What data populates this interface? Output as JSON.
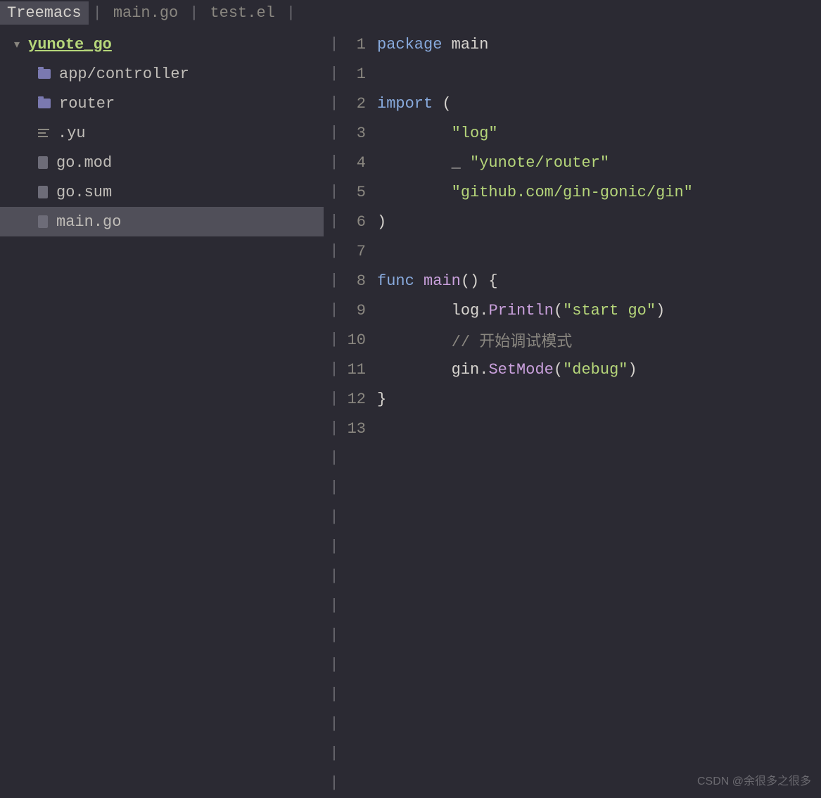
{
  "tabs": {
    "items": [
      "Treemacs",
      "main.go",
      "test.el"
    ],
    "active_index": 0,
    "separator": "|"
  },
  "tree": {
    "project": "yunote_go",
    "items": [
      {
        "type": "folder",
        "label": "app/controller"
      },
      {
        "type": "folder",
        "label": "router"
      },
      {
        "type": "text",
        "label": ".yu"
      },
      {
        "type": "file",
        "label": "go.mod"
      },
      {
        "type": "file",
        "label": "go.sum"
      },
      {
        "type": "file",
        "label": "main.go",
        "selected": true
      }
    ]
  },
  "editor": {
    "divider": "|",
    "lines": [
      {
        "n": "1",
        "tokens": [
          [
            "kw",
            "package "
          ],
          [
            "ident",
            "main"
          ]
        ]
      },
      {
        "n": "1",
        "tokens": []
      },
      {
        "n": "2",
        "tokens": [
          [
            "kw",
            "import "
          ],
          [
            "paren",
            "("
          ]
        ]
      },
      {
        "n": "3",
        "tokens": [
          [
            "ident",
            "        "
          ],
          [
            "str",
            "\"log\""
          ]
        ]
      },
      {
        "n": "4",
        "tokens": [
          [
            "ident",
            "        "
          ],
          [
            "punct",
            "_ "
          ],
          [
            "str",
            "\"yunote/router\""
          ]
        ]
      },
      {
        "n": "5",
        "tokens": [
          [
            "ident",
            "        "
          ],
          [
            "str",
            "\"github.com/gin-gonic/gin\""
          ]
        ]
      },
      {
        "n": "6",
        "tokens": [
          [
            "paren",
            ")"
          ]
        ]
      },
      {
        "n": "7",
        "tokens": []
      },
      {
        "n": "8",
        "tokens": [
          [
            "kw",
            "func "
          ],
          [
            "fn",
            "main"
          ],
          [
            "paren",
            "()"
          ],
          [
            "ident",
            " {"
          ]
        ]
      },
      {
        "n": "9",
        "tokens": [
          [
            "ident",
            "        log."
          ],
          [
            "fn",
            "Println"
          ],
          [
            "paren",
            "("
          ],
          [
            "str",
            "\"start go\""
          ],
          [
            "paren",
            ")"
          ]
        ]
      },
      {
        "n": "10",
        "tokens": [
          [
            "ident",
            "        "
          ],
          [
            "comment",
            "// 开始调试模式"
          ]
        ]
      },
      {
        "n": "11",
        "tokens": [
          [
            "ident",
            "        gin."
          ],
          [
            "fn",
            "SetMode"
          ],
          [
            "paren",
            "("
          ],
          [
            "str",
            "\"debug\""
          ],
          [
            "paren",
            ")"
          ]
        ]
      },
      {
        "n": "12",
        "tokens": [
          [
            "ident",
            "}"
          ]
        ]
      },
      {
        "n": "13",
        "tokens": []
      }
    ],
    "blank_rows_after": 12
  },
  "watermark": "CSDN @余很多之很多"
}
